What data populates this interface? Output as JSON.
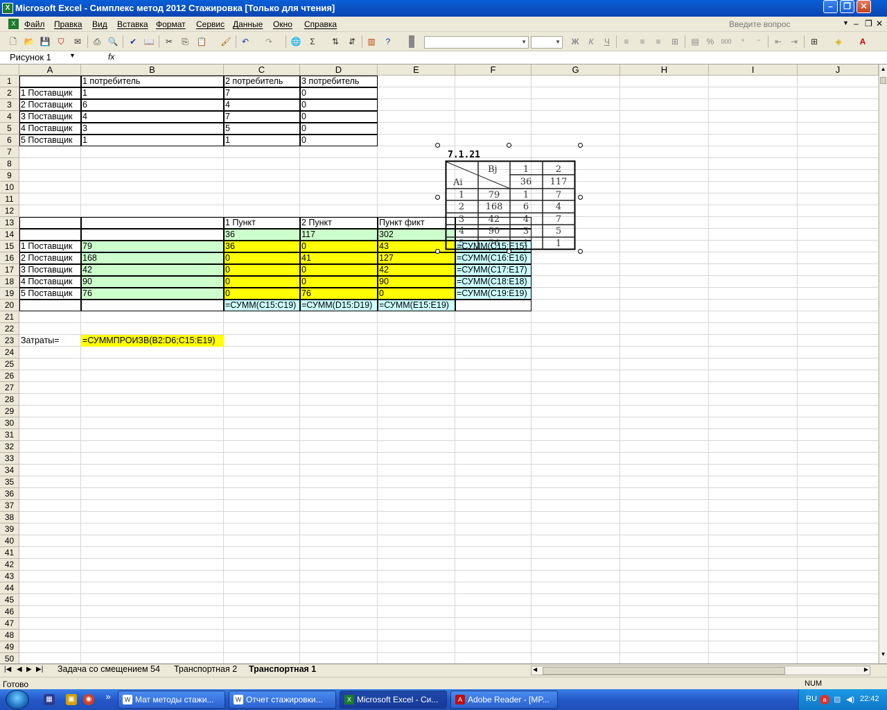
{
  "window": {
    "title": "Microsoft Excel - Симплекс метод 2012 Стажировка  [Только для чтения]",
    "app_icon": "excel-icon",
    "controls": [
      "minimize",
      "restore",
      "close"
    ]
  },
  "menu": {
    "items": [
      "Файл",
      "Правка",
      "Вид",
      "Вставка",
      "Формат",
      "Сервис",
      "Данные",
      "Окно",
      "Справка"
    ],
    "ask_placeholder": "Введите вопрос"
  },
  "toolbar": {
    "font_bold_icon": "Ж",
    "font_italic_icon": "К",
    "font_underline_icon": "Ч",
    "percent_icon": "%",
    "thousands_icon": "000"
  },
  "formula_bar": {
    "name_box": "Рисунок 1",
    "fx_label": "fx",
    "content": ""
  },
  "sheet": {
    "columns": [
      "A",
      "B",
      "C",
      "D",
      "E",
      "F",
      "G",
      "H",
      "I",
      "J"
    ],
    "cells": {
      "B1": "1 потребитель",
      "C1": "2 потребитель",
      "D1": "3 потребитель",
      "A2": "1 Поставщик",
      "B2": "1",
      "C2": "7",
      "D2": "0",
      "A3": "2 Поставщик",
      "B3": "6",
      "C3": "4",
      "D3": "0",
      "A4": "3 Поставщик",
      "B4": "4",
      "C4": "7",
      "D4": "0",
      "A5": "4 Поставщик",
      "B5": "3",
      "C5": "5",
      "D5": "0",
      "A6": "5 Поставщик",
      "B6": "1",
      "C6": "1",
      "D6": "0",
      "C13": "1 Пункт",
      "D13": "2 Пункт",
      "E13": "Пункт фикт",
      "C14": "36",
      "D14": "117",
      "E14": "302",
      "A15": "1 Поставщик",
      "B15": "79",
      "C15": "36",
      "D15": "0",
      "E15": "43",
      "F15": "=СУММ(C15:E15)",
      "A16": "2 Поставщик",
      "B16": "168",
      "C16": "0",
      "D16": "41",
      "E16": "127",
      "F16": "=СУММ(C16:E16)",
      "A17": "3 Поставщик",
      "B17": "42",
      "C17": "0",
      "D17": "0",
      "E17": "42",
      "F17": "=СУММ(C17:E17)",
      "A18": "4 Поставщик",
      "B18": "90",
      "C18": "0",
      "D18": "0",
      "E18": "90",
      "F18": "=СУММ(C18:E18)",
      "A19": "5 Поставщик",
      "B19": "76",
      "C19": "0",
      "D19": "76",
      "E19": "0",
      "F19": "=СУММ(C19:E19)",
      "C20": "=СУММ(C15:C19)",
      "D20": "=СУММ(D15:D19)",
      "E20": "=СУММ(E15:E19)",
      "A23": "Затраты=",
      "B23": "=СУММПРОИЗВ(B2:D6;C15:E19)"
    },
    "fills": {
      "green": "#ccffcc",
      "yellow": "#ffff00",
      "cyan": "#ccffff"
    }
  },
  "picture": {
    "caption": "7.1.21",
    "header_b": "Bj",
    "header_a": "Ai",
    "col_labels": [
      "1",
      "2"
    ],
    "demand": [
      "36",
      "117"
    ],
    "rows": [
      [
        "1",
        "79",
        "1",
        "7"
      ],
      [
        "2",
        "168",
        "6",
        "4"
      ],
      [
        "3",
        "42",
        "4",
        "7"
      ],
      [
        "4",
        "90",
        "3",
        "5"
      ],
      [
        "5",
        "76",
        "1",
        "1"
      ]
    ]
  },
  "tabs": {
    "items": [
      "Задача со смещением 54",
      "Транспортная 2",
      "Транспортная 1"
    ],
    "active": "Транспортная 1"
  },
  "status": {
    "text": "Готово",
    "num": "NUM"
  },
  "taskbar": {
    "tasks": [
      "Мат методы стажи...",
      "Отчет стажировки...",
      "Microsoft Excel - Си...",
      "Adobe Reader - [MP..."
    ],
    "overflow": "»",
    "lang": "RU",
    "clock": "22:42"
  }
}
